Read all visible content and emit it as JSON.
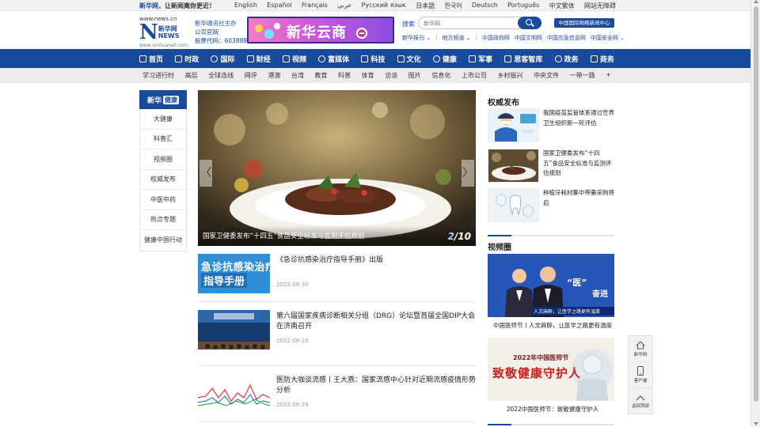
{
  "top_bar": {
    "greeting_brand": "新华网，",
    "greeting_text": "让新闻离你更近！",
    "languages": [
      "English",
      "Español",
      "Français",
      "عربي",
      "Русский язык",
      "日本語",
      "한국어",
      "Deutsch",
      "Português",
      "中文繁体",
      "网站无障碍"
    ]
  },
  "header": {
    "logo": {
      "url_top": "www.news.cn",
      "name": "新华网",
      "name_en": "NEWS",
      "url_bottom": "www.xinhuanet.com"
    },
    "org_lines": [
      "新华通讯社主办",
      "公司官网",
      "股票代码：603888"
    ],
    "ad_title": "新华云商",
    "search": {
      "label": "搜索",
      "placeholder": "新华网"
    },
    "gov_button": "中国国际网络新闻中心",
    "sub_links": [
      "新华报刊",
      "地方频道",
      "中国政府网",
      "中国文明网",
      "中国应急信息网",
      "中国安全网"
    ]
  },
  "main_nav": [
    {
      "label": "首页",
      "icon": "home-icon"
    },
    {
      "label": "时政",
      "icon": "politics-icon"
    },
    {
      "label": "国际",
      "icon": "globe-icon"
    },
    {
      "label": "财经",
      "icon": "finance-icon"
    },
    {
      "label": "视频",
      "icon": "video-icon"
    },
    {
      "label": "富媒体",
      "icon": "media-icon"
    },
    {
      "label": "科技",
      "icon": "tech-icon"
    },
    {
      "label": "文化",
      "icon": "culture-icon"
    },
    {
      "label": "健康",
      "icon": "health-icon"
    },
    {
      "label": "军事",
      "icon": "military-icon"
    },
    {
      "label": "思客智库",
      "icon": "thinktank-icon"
    },
    {
      "label": "政务",
      "icon": "gov-icon"
    },
    {
      "label": "商务",
      "icon": "business-icon"
    }
  ],
  "secondary_nav": [
    "学习进行时",
    "高层",
    "全球连线",
    "网评",
    "港澳",
    "台湾",
    "教育",
    "科普",
    "体育",
    "访谈",
    "图片",
    "信息化",
    "上市公司",
    "乡村振兴",
    "中央文件",
    "一带一路",
    "+"
  ],
  "sidebar": {
    "head_brand": "新华",
    "head_badge": "健康",
    "items": [
      "大健康",
      "科普汇",
      "视频圈",
      "权威发布",
      "中医中药",
      "热点专题",
      "健康中国行动"
    ]
  },
  "carousel": {
    "caption": "国家卫健委发布“十四五”食品安全标准与监测评估规划",
    "current": "2",
    "total": "/10",
    "prev": "〈",
    "next": "〉"
  },
  "news": [
    {
      "title": "《急诊抗感染治疗指导手册》出版",
      "date": "2022-08-30",
      "thumb_line1": "急诊抗感染治疗",
      "thumb_line2": "指导手册"
    },
    {
      "title": "第六届国家疾病诊断相关分组（DRG）论坛暨首届全国DIP大会在济南召开",
      "date": "2022-08-29"
    },
    {
      "title": "医防大咖谈流感丨王大燕：国家流感中心针对近期流感疫情形势分析",
      "date": "2022-08-29"
    }
  ],
  "right_column": {
    "authority_title": "权威发布",
    "authority_items": [
      "我国疫苗监管体系通过世界卫生组织新一轮评估",
      "国家卫健委发布“十四五”食品安全标准与监测评估规划",
      "种植牙耗材集中带量采购将启"
    ],
    "video_title": "视频圈",
    "video_items": [
      {
        "caption": "中国医师节丨人文麻醉，让医学之路更有温度",
        "overlay_main": "“医”",
        "overlay_sub": "奋进",
        "overlay_bottom": "人文麻醉，让医学之路更有温度"
      },
      {
        "caption": "2022中国医师节：致敬健康守护人",
        "overlay_top": "2022年中国医师节",
        "overlay_main": "致敬健康守护人"
      }
    ]
  },
  "float_tools": [
    "新华网",
    "客户端",
    "返回顶部"
  ]
}
